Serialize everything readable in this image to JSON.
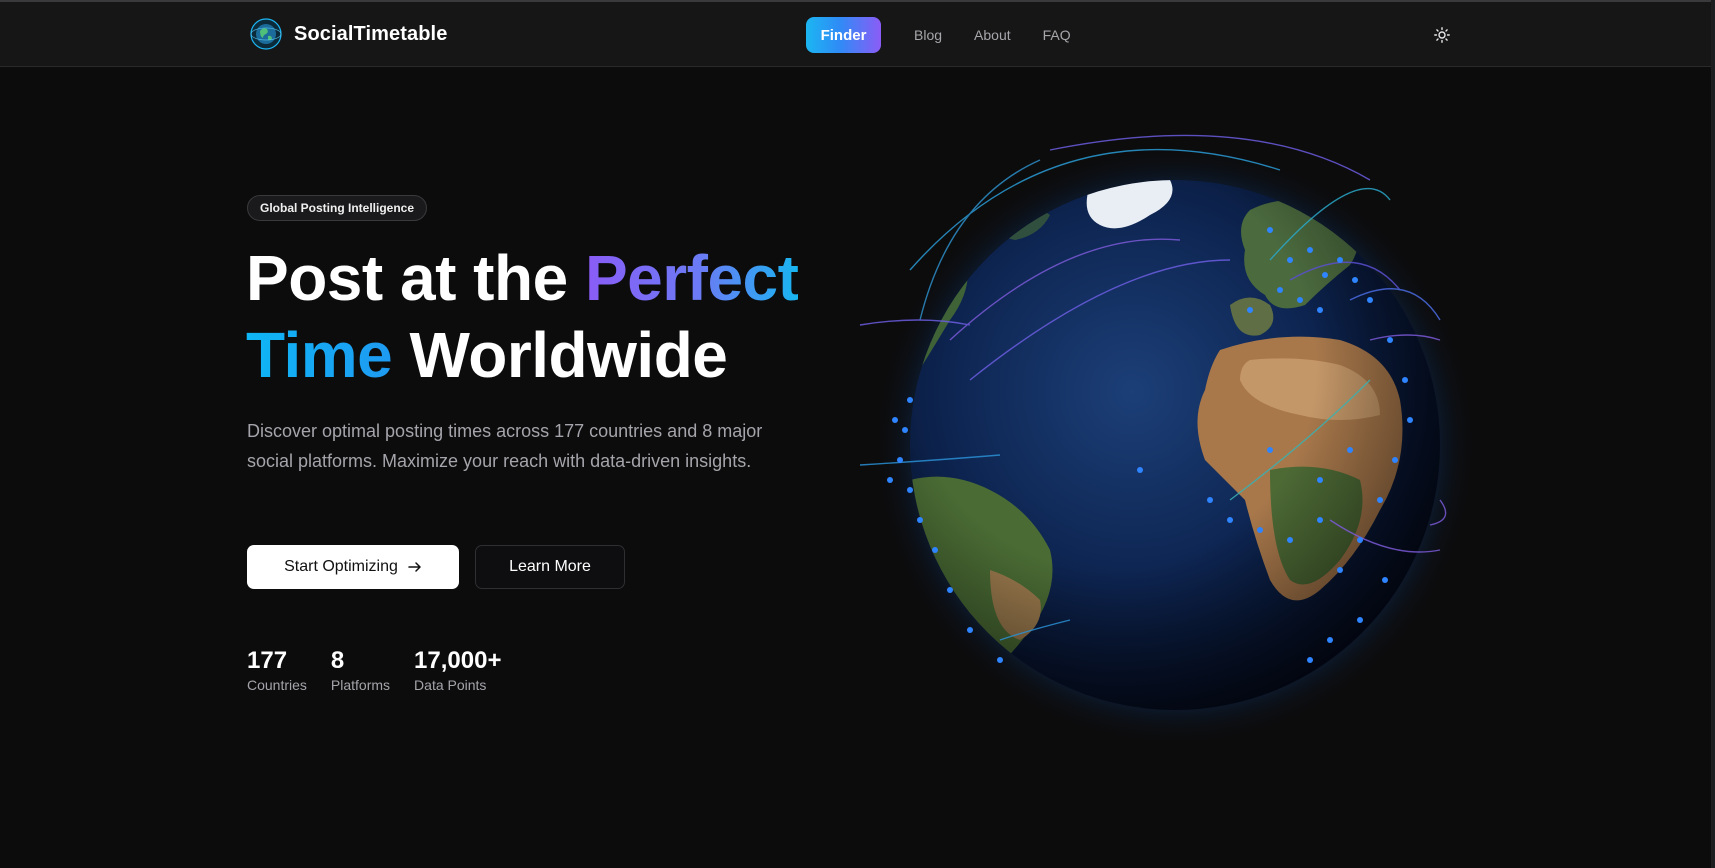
{
  "brand": {
    "name": "SocialTimetable",
    "logo_icon": "globe-logo-icon"
  },
  "nav": {
    "finder": "Finder",
    "links": [
      "Blog",
      "About",
      "FAQ"
    ],
    "theme_icon": "sun-icon"
  },
  "hero": {
    "badge": "Global Posting Intelligence",
    "headline": {
      "part1": "Post at the ",
      "highlight1": "Perfect",
      "highlight2": "Time",
      "part2": " Worldwide"
    },
    "subtitle": "Discover optimal posting times across 177 countries and 8 major social platforms. Maximize your reach with data-driven insights.",
    "primary_button": "Start Optimizing",
    "primary_button_icon": "arrow-right-icon",
    "secondary_button": "Learn More"
  },
  "stats": [
    {
      "value": "177",
      "label": "Countries"
    },
    {
      "value": "8",
      "label": "Platforms"
    },
    {
      "value": "17,000+",
      "label": "Data Points"
    }
  ],
  "colors": {
    "background": "#0c0c0d",
    "navbar": "#161617",
    "accent_cyan": "#18b5f0",
    "accent_purple": "#8a5cf6",
    "muted_text": "#a4a4aa"
  }
}
